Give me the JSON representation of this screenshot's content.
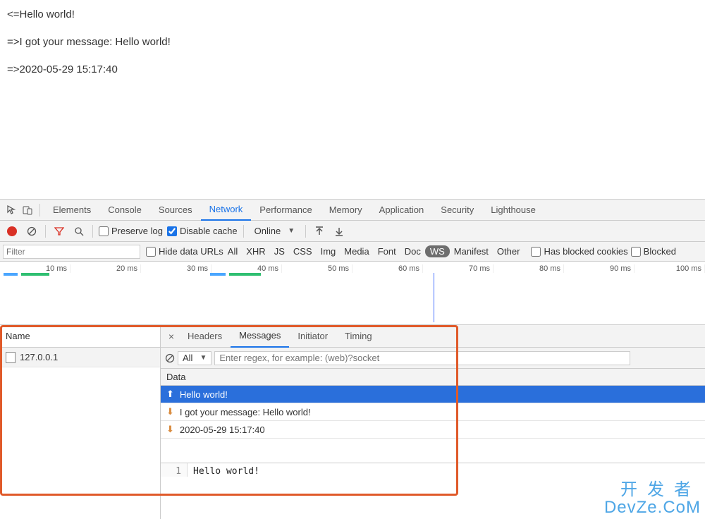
{
  "page_lines": [
    "<=Hello world!",
    "=>I got your message: Hello world!",
    "=>2020-05-29 15:17:40"
  ],
  "devtools": {
    "tabs": [
      "Elements",
      "Console",
      "Sources",
      "Network",
      "Performance",
      "Memory",
      "Application",
      "Security",
      "Lighthouse"
    ],
    "active_tab": "Network",
    "toolbar": {
      "preserve_log": "Preserve log",
      "disable_cache": "Disable cache",
      "throttle": "Online"
    },
    "filter": {
      "placeholder": "Filter",
      "hide_urls": "Hide data URLs",
      "types": [
        "All",
        "XHR",
        "JS",
        "CSS",
        "Img",
        "Media",
        "Font",
        "Doc",
        "WS",
        "Manifest",
        "Other"
      ],
      "active_type": "WS",
      "blocked_cookies": "Has blocked cookies",
      "blocked": "Blocked"
    },
    "timeline": {
      "ticks": [
        "10 ms",
        "20 ms",
        "30 ms",
        "40 ms",
        "50 ms",
        "60 ms",
        "70 ms",
        "80 ms",
        "90 ms",
        "100 ms"
      ]
    },
    "requests": {
      "header": "Name",
      "items": [
        "127.0.0.1"
      ]
    },
    "details": {
      "tabs": [
        "Headers",
        "Messages",
        "Initiator",
        "Timing"
      ],
      "active": "Messages",
      "msg_filter_all": "All",
      "regex_placeholder": "Enter regex, for example: (web)?socket",
      "data_header": "Data",
      "messages": [
        {
          "dir": "up",
          "text": "Hello world!",
          "selected": true
        },
        {
          "dir": "down",
          "text": "I got your message: Hello world!",
          "selected": false
        },
        {
          "dir": "down",
          "text": "2020-05-29 15:17:40",
          "selected": false
        }
      ],
      "preview_line_no": "1",
      "preview_text": "Hello world!"
    }
  },
  "watermark": {
    "cn": "开发者",
    "en": "DevZe.CoM"
  }
}
